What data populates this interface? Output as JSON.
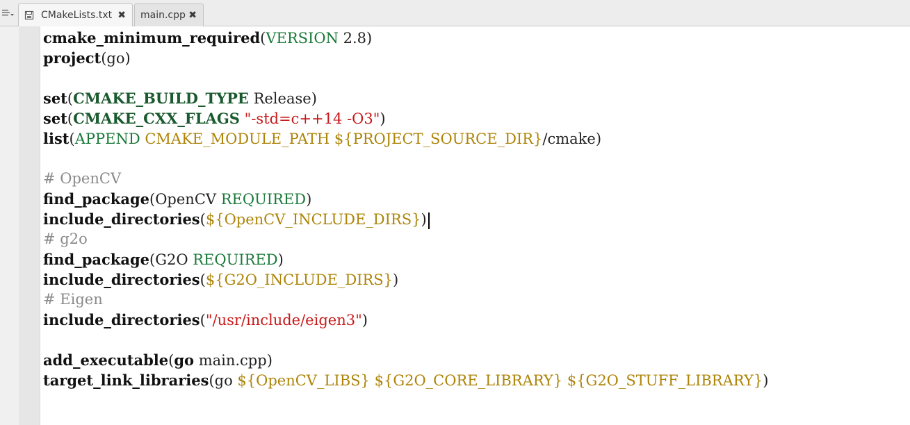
{
  "tabs": [
    {
      "label": "CMakeLists.txt",
      "icon": "document-icon",
      "close": "✖",
      "active": true
    },
    {
      "label": "main.cpp",
      "close": "✖",
      "active": false
    }
  ],
  "code": {
    "l1": {
      "fn": "cmake_minimum_required",
      "open": "(",
      "arg": "VERSION",
      "rest": " 2.8",
      "close": ")"
    },
    "l2": {
      "fn": "project",
      "open": "(",
      "rest": "go",
      "close": ")"
    },
    "l4": {
      "fn": "set",
      "open": "(",
      "var": "CMAKE_BUILD_TYPE",
      "rest": " Release",
      "close": ")"
    },
    "l5": {
      "fn": "set",
      "open": "(",
      "var": "CMAKE_CXX_FLAGS",
      "sp": " ",
      "str": "\"-std=c++14 -O3\"",
      "close": ")"
    },
    "l6": {
      "fn": "list",
      "open": "(",
      "arg": "APPEND",
      "sp": " ",
      "ref1": "CMAKE_MODULE_PATH",
      "sp2": " ",
      "ref2": "${PROJECT_SOURCE_DIR}",
      "rest": "/cmake",
      "close": ")"
    },
    "l8": {
      "comment": "# OpenCV"
    },
    "l9": {
      "fn": "find_package",
      "open": "(",
      "rest": "OpenCV ",
      "arg": "REQUIRED",
      "close": ")"
    },
    "l10": {
      "fn": "include_directories",
      "open": "(",
      "ref": "${OpenCV_INCLUDE_DIRS}",
      "close": ")"
    },
    "l11": {
      "comment": "# g2o"
    },
    "l12": {
      "fn": "find_package",
      "open": "(",
      "rest": "G2O ",
      "arg": "REQUIRED",
      "close": ")"
    },
    "l13": {
      "fn": "include_directories",
      "open": "(",
      "ref": "${G2O_INCLUDE_DIRS}",
      "close": ")"
    },
    "l14": {
      "comment": "# Eigen"
    },
    "l15": {
      "fn": "include_directories",
      "open": "(",
      "str": "\"/usr/include/eigen3\"",
      "close": ")"
    },
    "l17": {
      "fn": "add_executable",
      "open": "(",
      "target": "go",
      "rest": " main.cpp",
      "close": ")"
    },
    "l18": {
      "fn": "target_link_libraries",
      "open": "(",
      "rest": "go ",
      "ref1": "${OpenCV_LIBS}",
      "sp": " ",
      "ref2": "${G2O_CORE_LIBRARY}",
      "sp2": " ",
      "ref3": "${G2O_STUFF_LIBRARY}",
      "close": ")"
    }
  },
  "colors": {
    "keyword": "#111111",
    "variable": "#1a5a2e",
    "argument": "#1b7a3a",
    "string": "#c81919",
    "reference": "#ad8408",
    "comment": "#8a8a8a"
  }
}
